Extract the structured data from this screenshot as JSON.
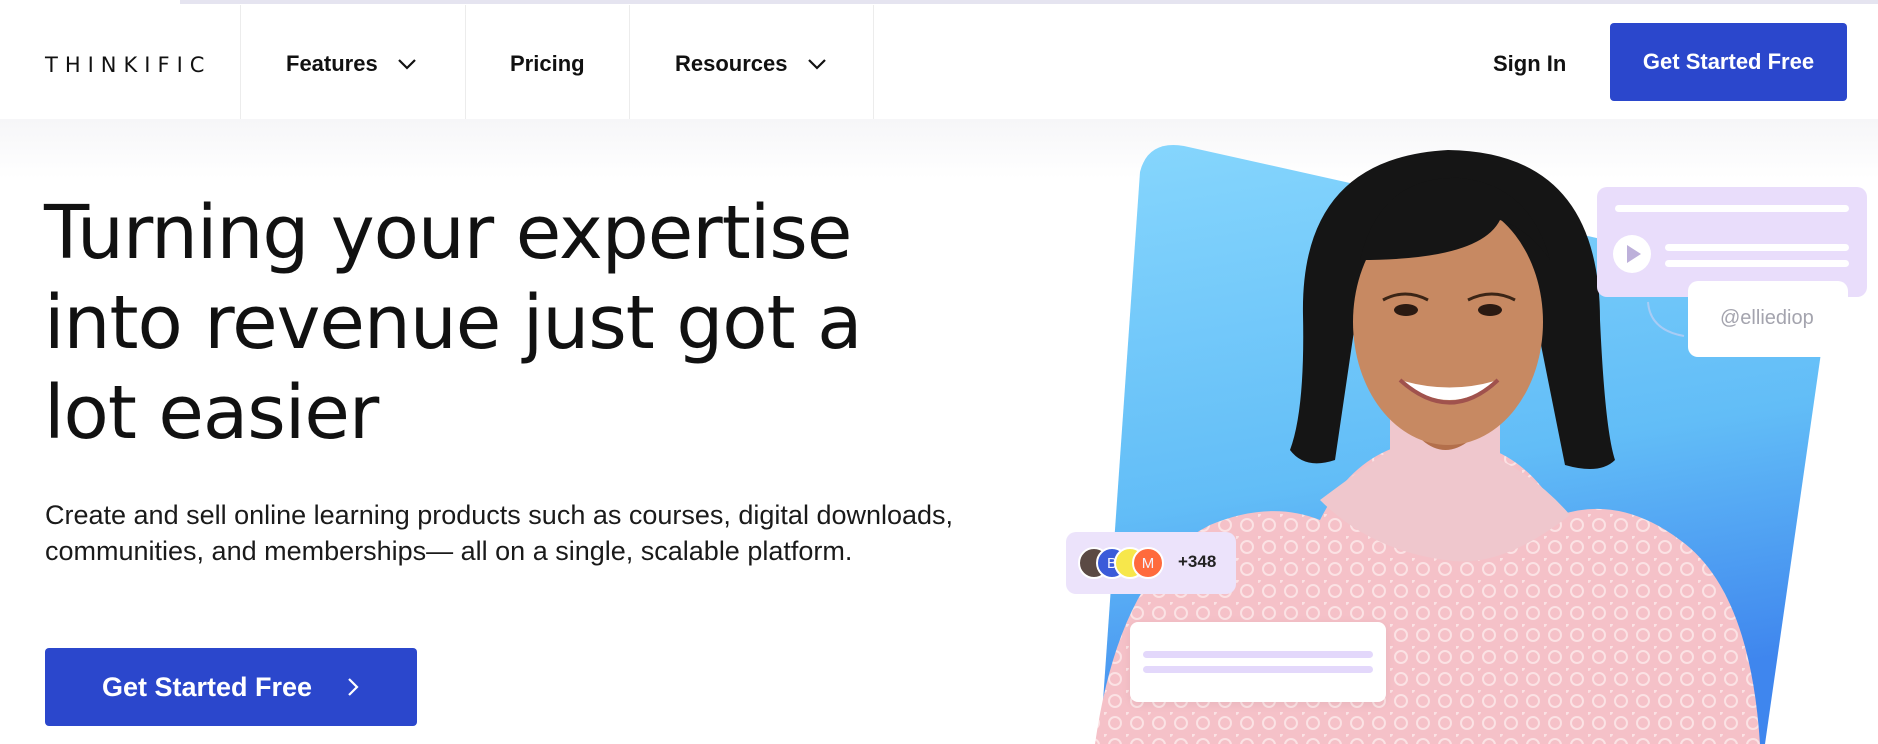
{
  "colors": {
    "brand_blue": "#2b47cc",
    "card_lilac": "#e9ddfb",
    "sky_blue": "#6ec8fb"
  },
  "nav": {
    "logo": "THINKIFIC",
    "items": [
      {
        "label": "Features",
        "has_dropdown": true
      },
      {
        "label": "Pricing",
        "has_dropdown": false
      },
      {
        "label": "Resources",
        "has_dropdown": true
      }
    ],
    "sign_in": "Sign In",
    "cta": "Get Started Free"
  },
  "hero": {
    "headline": "Turning your expertise into revenue just got a lot easier",
    "subtitle": "Create and sell online learning products such as courses, digital downloads, communities, and memberships— all on a single, scalable platform.",
    "cta": "Get Started Free"
  },
  "visual": {
    "handle": "@elliediop",
    "avatars": [
      "B",
      "M"
    ],
    "count": "+348",
    "icons": [
      "play-icon",
      "chevron-down-icon",
      "chevron-right-icon"
    ]
  }
}
